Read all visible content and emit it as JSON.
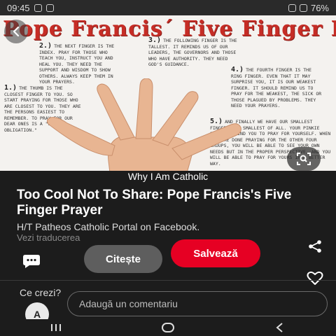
{
  "status": {
    "time": "09:45",
    "battery": "76%"
  },
  "image": {
    "title": "Pope Francis´ Five Finger Prayer",
    "notes": [
      {
        "num": "2.)",
        "text": "The next finger is the index. Pray for those who teach you, instruct you and heal you. They need the support and wisdom to show others. Always keep them in your prayers."
      },
      {
        "num": "3.)",
        "text": "The following finger is the tallest. It reminds us of our leaders, the governors and those who have authority. They need God's guidance."
      },
      {
        "num": "4.)",
        "text": "The fourth finger is the ring finger. Even that it may surprise you, it is our weakest finger. It should remind us to pray for the weakest, the sick or those plagued by problems. They need your prayers."
      },
      {
        "num": "1.)",
        "text": "The thumb is the closest finger to you. So start praying for those who are closest to you. They are the persons easiest to remember. To pray for our dear ones is a \"sweet obligation.\""
      },
      {
        "num": "5.)",
        "text": "And finally we have our smallest finger, the smallest of all. Your pinkie should remind you to pray for yourself. When you are done praying for the other four groups, you will be able to see your own needs but in the proper perspective, and you will be able to pray for yours in a better way."
      }
    ]
  },
  "pin": {
    "board": "Why I Am Catholic",
    "title": "Too Cool Not To Share: Pope Francis's Five Finger Prayer",
    "description": "H/T Patheos Catholic Portal on Facebook.",
    "translate": "Vezi traducerea",
    "read_label": "Citește",
    "save_label": "Salvează"
  },
  "comments": {
    "prompt": "Ce crezi?",
    "avatar_initial": "A",
    "placeholder": "Adaugă un comentariu"
  },
  "colors": {
    "accent": "#e60023",
    "title_red": "#c62d26"
  },
  "icons": [
    "back-arrow-icon",
    "lens-search-icon",
    "comment-icon",
    "share-icon",
    "heart-icon",
    "recents-icon",
    "home-icon",
    "back-icon"
  ]
}
